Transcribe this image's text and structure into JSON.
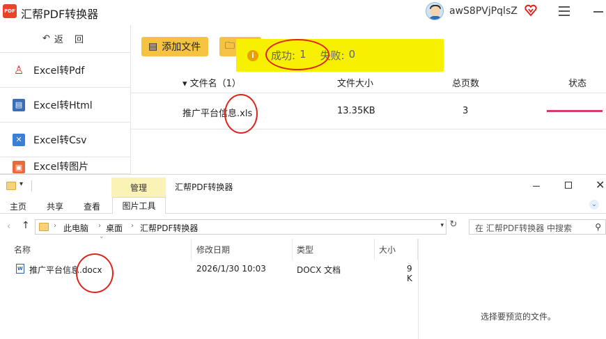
{
  "app": {
    "logo_text": "PDF",
    "title": "汇帮PDF转换器",
    "username": "awS8PVjPqlsZ"
  },
  "sidebar": {
    "back_label": "返 回",
    "items": [
      {
        "label": "Excel转Pdf",
        "icon": "pdf-icon"
      },
      {
        "label": "Excel转Html",
        "icon": "html-icon"
      },
      {
        "label": "Excel转Csv",
        "icon": "csv-icon"
      },
      {
        "label": "Excel转图片",
        "icon": "image-icon"
      }
    ]
  },
  "toolbar": {
    "add_file_label": "添加文件"
  },
  "table": {
    "headers": {
      "name": "▾ 文件名（1）",
      "size": "文件大小",
      "pages": "总页数",
      "status": "状态"
    },
    "rows": [
      {
        "name": "推广平台信息.xls",
        "size": "13.35KB",
        "pages": "3",
        "status_progress": 1.0
      }
    ]
  },
  "toast": {
    "success_label": "成功:",
    "success_count": "1",
    "fail_label": "失败:",
    "fail_count": "0"
  },
  "explorer": {
    "title": "汇帮PDF转换器",
    "manage_tab": "管理",
    "tabs": [
      "主页",
      "共享",
      "查看"
    ],
    "picture_tools_tab": "图片工具",
    "breadcrumbs": [
      "此电脑",
      "桌面",
      "汇帮PDF转换器"
    ],
    "search_placeholder": "在 汇帮PDF转换器 中搜索",
    "columns": {
      "name": "名称",
      "modified": "修改日期",
      "type": "类型",
      "size": "大小"
    },
    "files": [
      {
        "name": "推广平台信息.docx",
        "modified": "2026/1/30 10:03",
        "type": "DOCX 文档",
        "size": "9 K"
      }
    ],
    "preview_text": "选择要预览的文件。"
  },
  "colors": {
    "accent_yellow": "#f5c242",
    "toast_bg": "#f7f000",
    "progress": "#d63a6e",
    "annotation_red": "#e0221c"
  }
}
